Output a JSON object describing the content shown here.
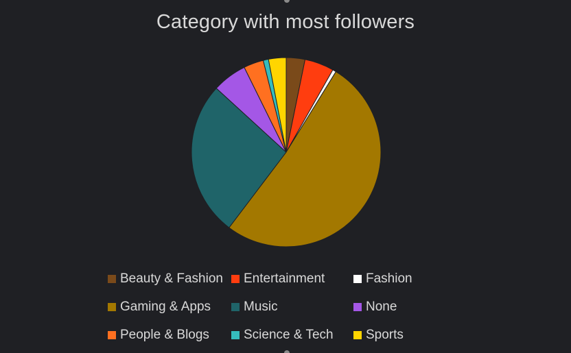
{
  "chart_data": {
    "type": "pie",
    "title": "Category with most followers",
    "legend_position": "bottom",
    "slices": [
      {
        "label": "Beauty & Fashion",
        "value": 3.2,
        "color": "#7a4a1a"
      },
      {
        "label": "Entertainment",
        "value": 5.0,
        "color": "#ff3d0f"
      },
      {
        "label": "Fashion",
        "value": 0.6,
        "color": "#ffffff"
      },
      {
        "label": "Gaming & Apps",
        "value": 51.5,
        "color": "#a37800"
      },
      {
        "label": "Music",
        "value": 26.5,
        "color": "#1f6469"
      },
      {
        "label": "None",
        "value": 5.9,
        "color": "#a457e6"
      },
      {
        "label": "People & Blogs",
        "value": 3.4,
        "color": "#ff7020"
      },
      {
        "label": "Science & Tech",
        "value": 0.9,
        "color": "#36bcbd"
      },
      {
        "label": "Sports",
        "value": 3.0,
        "color": "#ffd500"
      }
    ]
  }
}
